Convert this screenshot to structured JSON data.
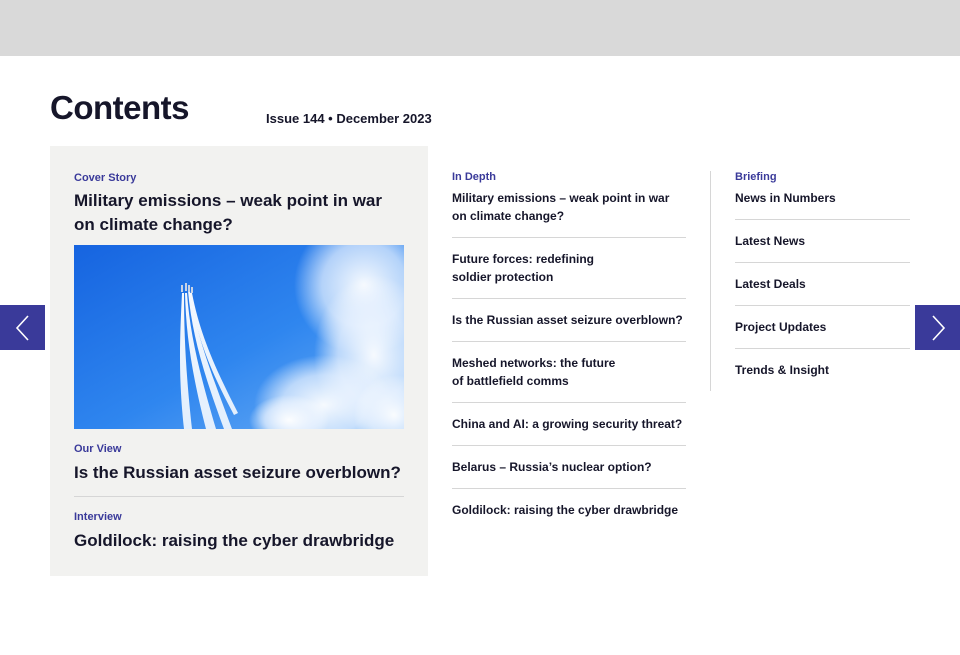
{
  "page": {
    "title": "Contents",
    "issue": "Issue 144 • December 2023"
  },
  "feature": {
    "cover": {
      "kicker": "Cover Story",
      "title": "Military emissions – weak point in war on climate change?"
    },
    "image": {
      "icon": "jets-contrails-sky-image"
    },
    "our_view": {
      "kicker": "Our View",
      "title": "Is the Russian asset seizure overblown?"
    },
    "interview": {
      "kicker": "Interview",
      "title": "Goldilock: raising the cyber drawbridge"
    }
  },
  "in_depth": {
    "kicker": "In Depth",
    "items": [
      {
        "line1": "Military emissions – weak point in war",
        "line2": "on climate change?"
      },
      {
        "line1": "Future forces: redefining",
        "line2": "soldier protection"
      },
      {
        "line1": "Is the Russian asset seizure overblown?",
        "line2": ""
      },
      {
        "line1": "Meshed networks: the future",
        "line2": "of battlefield comms"
      },
      {
        "line1": "China and AI: a growing security threat?",
        "line2": ""
      },
      {
        "line1": "Belarus – Russia’s nuclear option?",
        "line2": ""
      },
      {
        "line1": "Goldilock: raising the cyber drawbridge",
        "line2": ""
      }
    ]
  },
  "briefing": {
    "kicker": "Briefing",
    "items": [
      "News in Numbers",
      "Latest News",
      "Latest Deals",
      "Project Updates",
      "Trends & Insight"
    ]
  },
  "nav": {
    "prev_icon": "chevron-left-icon",
    "next_icon": "chevron-right-icon"
  },
  "colors": {
    "accent": "#3a3a9a",
    "panel": "#f2f2f0",
    "topbar": "#d9d9d9",
    "text": "#16162a"
  }
}
